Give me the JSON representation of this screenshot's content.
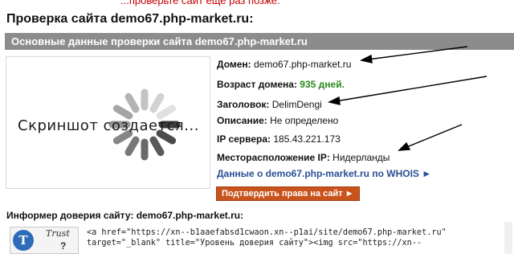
{
  "top_note": "...проверьте сайт еще раз позже.",
  "page_title": "Проверка сайта demo67.php-market.ru:",
  "section_title": "Основные данные проверки сайта demo67.php-market.ru",
  "screenshot_placeholder": "Скриншот создается...",
  "info": {
    "domain_label": "Домен:",
    "domain_value": "demo67.php-market.ru",
    "age_label": "Возраст домена:",
    "age_value": "935 дней.",
    "title_label": "Заголовок:",
    "title_value": "DelimDengi",
    "description_label": "Описание:",
    "description_value": "Не определено",
    "ip_label": "IP сервера:",
    "ip_value": "185.43.221.173",
    "location_label": "Месторасположение IP:",
    "location_value": "Нидерланды"
  },
  "whois_link": "Данные о demo67.php-market.ru по WHOIS ►",
  "confirm_button": "Подтвердить права на сайт ►",
  "informer_title": "Информер доверия сайту: demo67.php-market.ru:",
  "trust_badge": {
    "word": "Trust",
    "question": "?"
  },
  "code_lines": [
    "<a href=\"https://xn--b1aaefabsd1cwaon.xn--p1ai/site/demo67.php-market.ru\"",
    "target=\"_blank\" title=\"Уровень доверия сайту\"><img src=\"https://xn--"
  ],
  "colors": {
    "section_bar": "#8c8c8c",
    "age_green": "#2a8a1e",
    "link_blue": "#2a4f96",
    "button_orange": "#c8531c",
    "annotation_arrows": "#000000"
  }
}
